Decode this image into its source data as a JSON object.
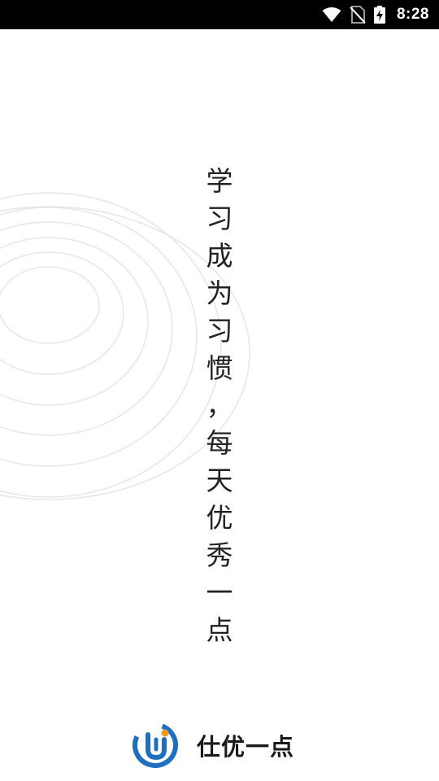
{
  "status_bar": {
    "time": "8:28",
    "icons": [
      "wifi-icon",
      "no-sim-icon",
      "battery-charging-icon"
    ]
  },
  "slogan": {
    "characters": [
      "学",
      "习",
      "成",
      "为",
      "习",
      "惯",
      "，",
      "每",
      "天",
      "优",
      "秀",
      "一",
      "点"
    ]
  },
  "brand": {
    "name": "仕优一点",
    "logo_colors": {
      "blue": "#1f6fc0",
      "orange": "#f39a1e"
    }
  },
  "colors": {
    "background": "#ffffff",
    "status_bar": "#000000",
    "ring_stroke": "#e6e6e6",
    "slogan_text": "#222222"
  }
}
